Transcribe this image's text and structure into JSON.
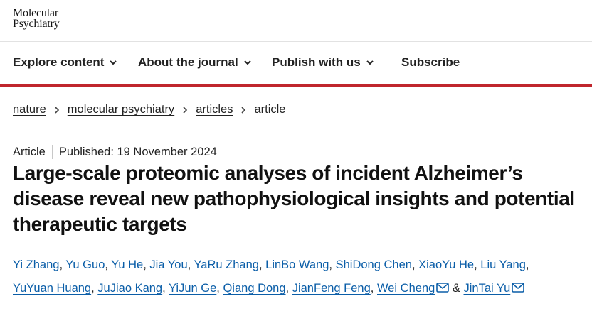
{
  "header": {
    "logo_line1": "Molecular",
    "logo_line2": "Psychiatry"
  },
  "nav": {
    "items": [
      {
        "label": "Explore content",
        "has_dropdown": true
      },
      {
        "label": "About the journal",
        "has_dropdown": true
      },
      {
        "label": "Publish with us",
        "has_dropdown": true
      },
      {
        "label": "Subscribe",
        "has_dropdown": false
      }
    ],
    "accent_color": "#c0262d"
  },
  "breadcrumb": [
    "nature",
    "molecular psychiatry",
    "articles",
    "article"
  ],
  "meta": {
    "type": "Article",
    "published": "Published: 19 November 2024"
  },
  "title": "Large-scale proteomic analyses of incident Alzheimer’s disease reveal new pathophysiological insights and potential therapeutic targets",
  "authors": {
    "row1": [
      "Yi Zhang",
      "Yu Guo",
      "Yu He",
      "Jia You",
      "YaRu Zhang",
      "LinBo Wang",
      "ShiDong Chen",
      "XiaoYu He",
      "Liu Yang"
    ],
    "row2": [
      "YuYuan Huang",
      "JuJiao Kang",
      "YiJun Ge",
      "Qiang Dong",
      "JianFeng Feng",
      "Wei Cheng",
      "JinTai Yu"
    ],
    "separator": ",",
    "ampersand": "&",
    "link_color": "#0b5ea8"
  }
}
